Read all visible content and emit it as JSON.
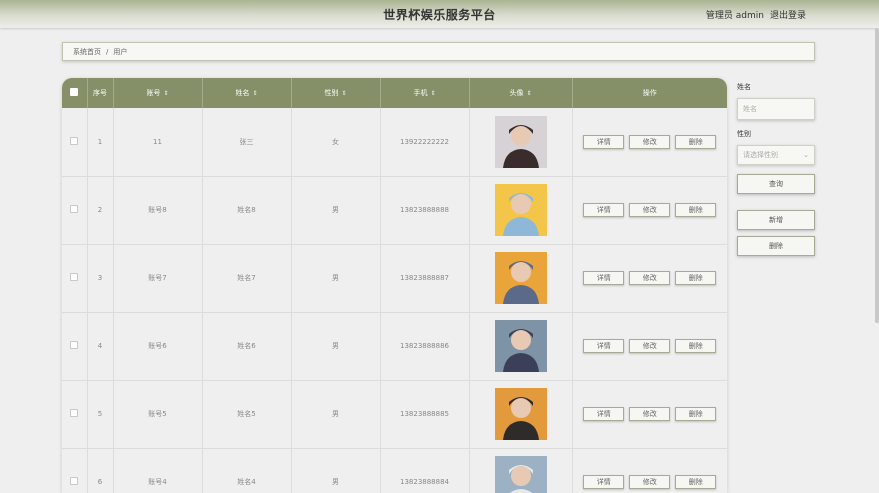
{
  "header": {
    "title": "世界杯娱乐服务平台",
    "user": "管理员 admin",
    "logout": "退出登录"
  },
  "breadcrumb": {
    "home": "系统首页",
    "separator": "/",
    "current": "用户"
  },
  "table": {
    "columns": [
      "序号",
      "账号",
      "姓名",
      "性别",
      "手机",
      "头像",
      "操作"
    ],
    "sort_icon": "sort-icon",
    "actions": {
      "detail": "详情",
      "edit": "修改",
      "delete": "删除"
    },
    "rows": [
      {
        "index": "1",
        "account": "11",
        "name": "张三",
        "gender": "女",
        "phone": "13922222222",
        "avatar": "avatar-icon"
      },
      {
        "index": "2",
        "account": "账号8",
        "name": "姓名8",
        "gender": "男",
        "phone": "13823888888",
        "avatar": "avatar-icon"
      },
      {
        "index": "3",
        "account": "账号7",
        "name": "姓名7",
        "gender": "男",
        "phone": "13823888887",
        "avatar": "avatar-icon"
      },
      {
        "index": "4",
        "account": "账号6",
        "name": "姓名6",
        "gender": "男",
        "phone": "13823888886",
        "avatar": "avatar-icon"
      },
      {
        "index": "5",
        "account": "账号5",
        "name": "姓名5",
        "gender": "男",
        "phone": "13823888885",
        "avatar": "avatar-icon"
      },
      {
        "index": "6",
        "account": "账号4",
        "name": "姓名4",
        "gender": "男",
        "phone": "13823888884",
        "avatar": "avatar-icon"
      }
    ]
  },
  "sidebar": {
    "name_label": "姓名",
    "name_placeholder": "姓名",
    "gender_label": "性别",
    "gender_placeholder": "请选择性别",
    "query": "查询",
    "add": "新增",
    "delete": "删除"
  },
  "colors": {
    "header_bg": "#858f68",
    "page_bg": "#efefef"
  }
}
